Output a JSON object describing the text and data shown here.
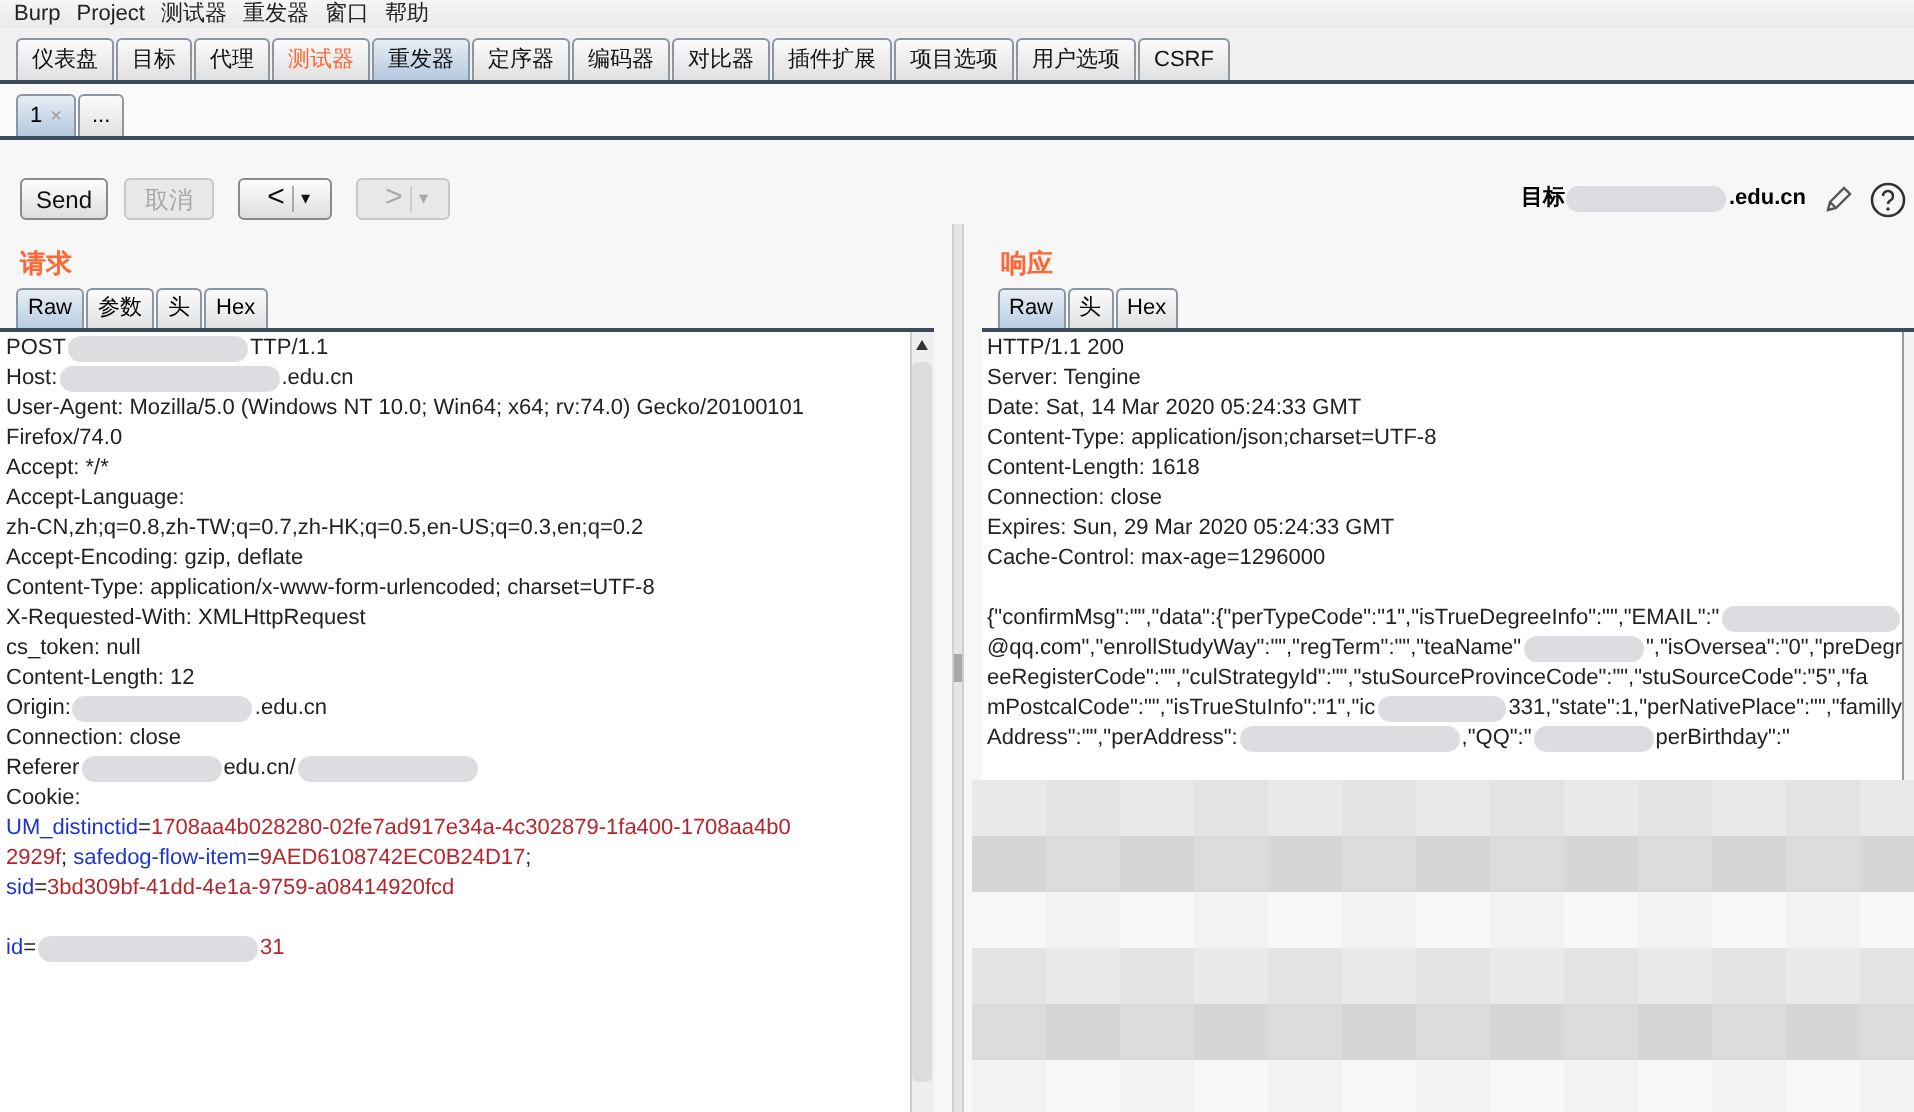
{
  "menu": [
    "Burp",
    "Project",
    "测试器",
    "重发器",
    "窗口",
    "帮助"
  ],
  "tabs": [
    {
      "label": "仪表盘",
      "selected": false,
      "highlighted": false
    },
    {
      "label": "目标",
      "selected": false,
      "highlighted": false
    },
    {
      "label": "代理",
      "selected": false,
      "highlighted": false
    },
    {
      "label": "测试器",
      "selected": false,
      "highlighted": true
    },
    {
      "label": "重发器",
      "selected": true,
      "highlighted": false
    },
    {
      "label": "定序器",
      "selected": false,
      "highlighted": false
    },
    {
      "label": "编码器",
      "selected": false,
      "highlighted": false
    },
    {
      "label": "对比器",
      "selected": false,
      "highlighted": false
    },
    {
      "label": "插件扩展",
      "selected": false,
      "highlighted": false
    },
    {
      "label": "项目选项",
      "selected": false,
      "highlighted": false
    },
    {
      "label": "用户选项",
      "selected": false,
      "highlighted": false
    },
    {
      "label": "CSRF",
      "selected": false,
      "highlighted": false
    }
  ],
  "subtabs": [
    {
      "label": "1",
      "close": "×",
      "selected": true
    },
    {
      "label": "...",
      "selected": false
    }
  ],
  "toolbar": {
    "send": {
      "label": "Send",
      "disabled": false
    },
    "cancel": {
      "label": "取消",
      "disabled": true
    },
    "back": {
      "label": "<",
      "caret": "▾",
      "disabled": false
    },
    "forward": {
      "label": ">",
      "caret": "▾",
      "disabled": true
    }
  },
  "target": {
    "label": "目标",
    "host": ".edu.cn"
  },
  "request": {
    "title": "请求",
    "tabs": [
      {
        "label": "Raw",
        "selected": true
      },
      {
        "label": "参数",
        "selected": false
      },
      {
        "label": "头",
        "selected": false
      },
      {
        "label": "Hex",
        "selected": false
      }
    ],
    "lines": [
      [
        {
          "kind": "text",
          "t": "POST"
        },
        {
          "kind": "redacted"
        },
        {
          "kind": "text",
          "t": "TTP/1.1"
        }
      ],
      [
        {
          "kind": "text",
          "t": "Host:"
        },
        {
          "kind": "redacted"
        },
        {
          "kind": "text",
          "t": ".edu.cn"
        }
      ],
      [
        {
          "kind": "text",
          "t": "User-Agent: Mozilla/5.0 (Windows NT 10.0; Win64; x64; rv:74.0) Gecko/20100101"
        }
      ],
      [
        {
          "kind": "text",
          "t": "Firefox/74.0"
        }
      ],
      [
        {
          "kind": "text",
          "t": "Accept: */*"
        }
      ],
      [
        {
          "kind": "text",
          "t": "Accept-Language:"
        }
      ],
      [
        {
          "kind": "text",
          "t": "zh-CN,zh;q=0.8,zh-TW;q=0.7,zh-HK;q=0.5,en-US;q=0.3,en;q=0.2"
        }
      ],
      [
        {
          "kind": "text",
          "t": "Accept-Encoding: gzip, deflate"
        }
      ],
      [
        {
          "kind": "text",
          "t": "Content-Type: application/x-www-form-urlencoded; charset=UTF-8"
        }
      ],
      [
        {
          "kind": "text",
          "t": "X-Requested-With: XMLHttpRequest"
        }
      ],
      [
        {
          "kind": "text",
          "t": "cs_token: null"
        }
      ],
      [
        {
          "kind": "text",
          "t": "Content-Length: 12"
        }
      ],
      [
        {
          "kind": "text",
          "t": "Origin:"
        },
        {
          "kind": "redacted"
        },
        {
          "kind": "text",
          "t": ".edu.cn"
        }
      ],
      [
        {
          "kind": "text",
          "t": "Connection: close"
        }
      ],
      [
        {
          "kind": "text",
          "t": "Referer"
        },
        {
          "kind": "redacted"
        },
        {
          "kind": "text",
          "t": "edu.cn/"
        },
        {
          "kind": "redacted"
        }
      ],
      [
        {
          "kind": "text",
          "t": "Cookie:"
        }
      ],
      [
        {
          "kind": "key",
          "t": "UM_distinctid"
        },
        {
          "kind": "text",
          "t": "="
        },
        {
          "kind": "value",
          "t": "1708aa4b028280-02fe7ad917e34a-4c302879-1fa400-1708aa4b0"
        }
      ],
      [
        {
          "kind": "value",
          "t": "2929f"
        },
        {
          "kind": "text",
          "t": "; "
        },
        {
          "kind": "key",
          "t": "safedog-flow-item"
        },
        {
          "kind": "text",
          "t": "="
        },
        {
          "kind": "value",
          "t": "9AED6108742EC0B24D17"
        },
        {
          "kind": "text",
          "t": ";"
        }
      ],
      [
        {
          "kind": "key",
          "t": "sid"
        },
        {
          "kind": "text",
          "t": "="
        },
        {
          "kind": "value",
          "t": "3bd309bf-41dd-4e1a-9759-a08414920fcd"
        }
      ],
      [
        {
          "kind": "blank"
        }
      ],
      [
        {
          "kind": "key",
          "t": "id"
        },
        {
          "kind": "text",
          "t": "="
        },
        {
          "kind": "redacted"
        },
        {
          "kind": "value",
          "t": "31"
        }
      ]
    ]
  },
  "response": {
    "title": "响应",
    "tabs": [
      {
        "label": "Raw",
        "selected": true
      },
      {
        "label": "头",
        "selected": false
      },
      {
        "label": "Hex",
        "selected": false
      }
    ],
    "lines": [
      [
        {
          "kind": "text",
          "t": "HTTP/1.1 200"
        }
      ],
      [
        {
          "kind": "text",
          "t": "Server: Tengine"
        }
      ],
      [
        {
          "kind": "text",
          "t": "Date: Sat, 14 Mar 2020 05:24:33 GMT"
        }
      ],
      [
        {
          "kind": "text",
          "t": "Content-Type: application/json;charset=UTF-8"
        }
      ],
      [
        {
          "kind": "text",
          "t": "Content-Length: 1618"
        }
      ],
      [
        {
          "kind": "text",
          "t": "Connection: close"
        }
      ],
      [
        {
          "kind": "text",
          "t": "Expires: Sun, 29 Mar 2020 05:24:33 GMT"
        }
      ],
      [
        {
          "kind": "text",
          "t": "Cache-Control: max-age=1296000"
        }
      ],
      [
        {
          "kind": "blank"
        }
      ],
      [
        {
          "kind": "text",
          "t": "{\"confirmMsg\":\"\",\"data\":{\"perTypeCode\":\"1\",\"isTrueDegreeInfo\":\"\",\"EMAIL\":\""
        },
        {
          "kind": "redacted"
        }
      ],
      [
        {
          "kind": "text",
          "t": "@qq.com\",\"enrollStudyWay\":\"\",\"regTerm\":\"\",\"teaName\""
        },
        {
          "kind": "redacted"
        },
        {
          "kind": "text",
          "t": "\",\"isOversea\":\"0\",\"preDegr"
        }
      ],
      [
        {
          "kind": "text",
          "t": "eeRegisterCode\":\"\",\"culStrategyId\":\"\",\"stuSourceProvinceCode\":\"\",\"stuSourceCode\":\"5\",\"fa"
        }
      ],
      [
        {
          "kind": "text",
          "t": "mPostcalCode\":\"\",\"isTrueStuInfo\":\"1\",\"ic"
        },
        {
          "kind": "redacted"
        },
        {
          "kind": "text",
          "t": "331,\"state\":1,\"perNativePlace\":\"\",\"familly"
        }
      ],
      [
        {
          "kind": "text",
          "t": "Address\":\"\",\"perAddress\":"
        },
        {
          "kind": "redacted"
        },
        {
          "kind": "text",
          "t": ",\"QQ\":\""
        },
        {
          "kind": "redacted"
        },
        {
          "kind": "text",
          "t": "perBirthday\":\""
        }
      ]
    ]
  }
}
